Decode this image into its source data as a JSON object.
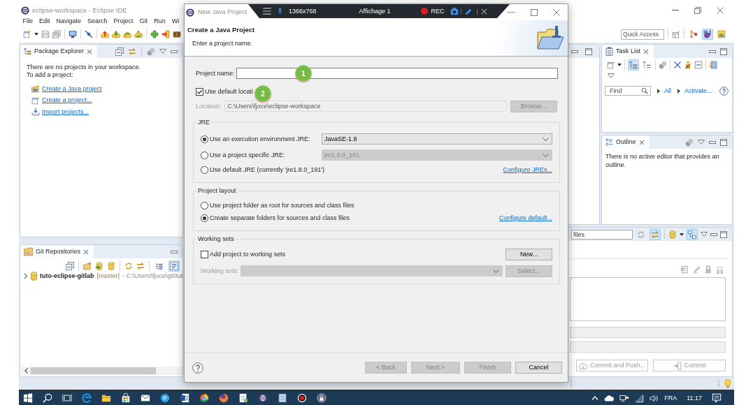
{
  "window": {
    "title": "eclipse-workspace - Eclipse IDE"
  },
  "menu": [
    "File",
    "Edit",
    "Navigate",
    "Search",
    "Project",
    "Git",
    "Run",
    "Wi"
  ],
  "main_toolbar": {
    "quick_access": {
      "placeholder": "Quick Access"
    },
    "perspectives": [
      {
        "selected": false
      },
      {
        "selected": true
      },
      {
        "selected": false
      }
    ]
  },
  "package_explorer": {
    "title": "Package Explorer",
    "message": [
      "There are no projects in your workspace.",
      "To add a project:"
    ],
    "links": [
      "Create a Java project",
      "Create a project...",
      "Import projects..."
    ]
  },
  "git_repositories": {
    "title": "Git Repositories",
    "toggles": [
      {
        "on": false
      },
      {
        "on": true
      }
    ],
    "repositories": [
      {
        "name": "tuto-eclipse-gitlab",
        "branch": "[master]",
        "path": "- C:\\Users\\fjoce\\git\\tut",
        "expanded": false
      }
    ]
  },
  "task_list": {
    "title": "Task List",
    "toggles": [
      {
        "on": true
      },
      {
        "on": false
      }
    ],
    "find": {
      "placeholder": "Find"
    },
    "filters": [
      "All",
      "Activate..."
    ]
  },
  "outline": {
    "title": "Outline",
    "message": "There is no active editor that provides an outline."
  },
  "staging": {
    "filter": {
      "placeholder": "files"
    },
    "toggles": [
      {
        "on": false
      },
      {
        "on": true
      },
      {
        "on": true
      }
    ],
    "buttons": [
      {
        "label": "Commit and Push...",
        "disabled": true
      },
      {
        "label": "Commit",
        "disabled": true
      }
    ]
  },
  "dialog": {
    "title": "New Java Project",
    "heading": "Create a Java Project",
    "message": "Enter a project name.",
    "project_name": {
      "label": "Project name:"
    },
    "use_default_location": {
      "label": "Use default locati",
      "checked": true
    },
    "location": {
      "label": "Location:",
      "value": "C:\\Users\\fjoce\\eclipse-workspace",
      "disabled": true
    },
    "browse_button": {
      "label": "Browse...",
      "disabled": true
    },
    "jre_group": {
      "title": "JRE",
      "options": [
        {
          "label": "Use an execution environment JRE:",
          "selected": true,
          "dropdown": {
            "value": "JavaSE-1.8",
            "disabled": false
          }
        },
        {
          "label": "Use a project specific JRE:",
          "selected": false,
          "dropdown": {
            "value": "jre1.8.0_191",
            "disabled": true
          }
        },
        {
          "label": "Use default JRE (currently 'jre1.8.0_191')",
          "selected": false,
          "link": "Configure JREs..."
        }
      ]
    },
    "layout_group": {
      "title": "Project layout",
      "options": [
        {
          "label": "Use project folder as root for sources and class files",
          "selected": false
        },
        {
          "label": "Create separate folders for sources and class files",
          "selected": true,
          "link": "Configure default..."
        }
      ]
    },
    "working_sets_group": {
      "title": "Working sets",
      "checkbox": {
        "label": "Add project to working sets",
        "checked": false
      },
      "new_button": {
        "label": "New...",
        "disabled": false
      },
      "field": {
        "label": "Working sets:",
        "disabled": true
      },
      "select_button": {
        "label": "Select...",
        "disabled": true
      }
    },
    "buttons": [
      {
        "label": "< Back",
        "disabled": true
      },
      {
        "label": "Next >",
        "disabled": true
      },
      {
        "label": "Finish",
        "disabled": true
      },
      {
        "label": "Cancel",
        "disabled": false
      }
    ]
  },
  "recorder": {
    "resolution": "1366x768",
    "display": "Affichage 1",
    "status": "REC"
  },
  "step_markers": [
    "1",
    "2"
  ],
  "taskbar": {
    "language": "FRA",
    "time": "11:17"
  }
}
